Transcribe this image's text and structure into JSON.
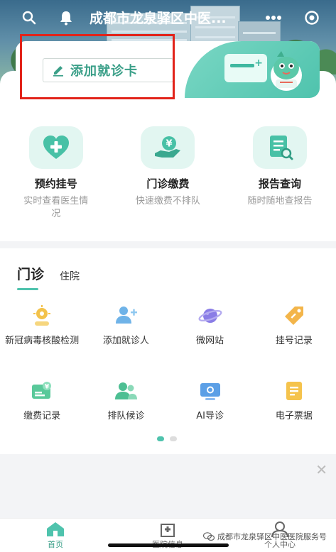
{
  "header": {
    "title": "成都市龙泉驿区中医...",
    "icons": [
      "search-icon",
      "bell-icon",
      "more-icon",
      "target-icon"
    ]
  },
  "card": {
    "button_label": "添加就诊卡",
    "icon": "pencil-icon",
    "art": "mascot-card-illustration"
  },
  "quick_actions": [
    {
      "title": "预约挂号",
      "subtitle": "实时查看医生情况",
      "icon": "heart-plus-icon"
    },
    {
      "title": "门诊缴费",
      "subtitle": "快速缴费不排队",
      "icon": "hand-yen-icon"
    },
    {
      "title": "报告查询",
      "subtitle": "随时随地查报告",
      "icon": "report-search-icon"
    }
  ],
  "tabs": {
    "active": "门诊",
    "inactive": "住院"
  },
  "services": [
    {
      "label": "新冠病毒核酸检测",
      "icon": "virus-test-icon"
    },
    {
      "label": "添加就诊人",
      "icon": "add-person-icon"
    },
    {
      "label": "微网站",
      "icon": "planet-icon"
    },
    {
      "label": "挂号记录",
      "icon": "ticket-tag-icon"
    },
    {
      "label": "缴费记录",
      "icon": "payment-record-icon"
    },
    {
      "label": "排队候诊",
      "icon": "queue-people-icon"
    },
    {
      "label": "AI导诊",
      "icon": "ai-screen-icon"
    },
    {
      "label": "电子票据",
      "icon": "e-receipt-icon"
    }
  ],
  "pager": {
    "pages": 2,
    "current": 1
  },
  "bottom_nav": {
    "home": "首页",
    "hospital": "医院信息",
    "me": "个人中心"
  },
  "watermark": "成都市龙泉驿区中医医院服务号",
  "colors": {
    "accent": "#4fc3ad",
    "accent_text": "#3a9f88",
    "highlight": "#e2231a"
  }
}
